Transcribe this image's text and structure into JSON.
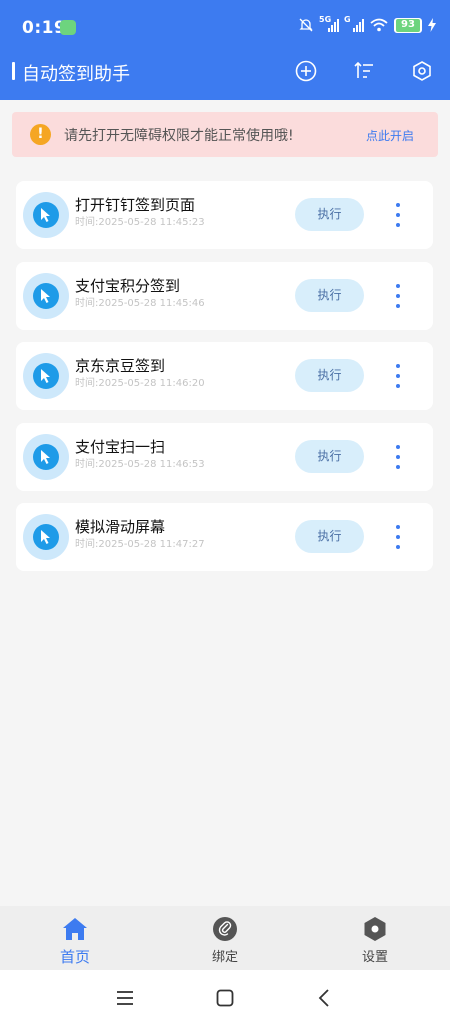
{
  "status_bar": {
    "time": "0:19",
    "network_1": "5G",
    "network_2": "G",
    "battery": "93"
  },
  "app_bar": {
    "title": "自动签到助手",
    "icons": [
      "add-circle-icon",
      "sort-icon",
      "settings-hexagon-icon"
    ]
  },
  "notice": {
    "icon": "warning-icon",
    "icon_glyph": "!",
    "text": "请先打开无障碍权限才能正常使用哦!",
    "action": "点此开启"
  },
  "tasks": [
    {
      "name": "打开钉钉签到页面",
      "time": "时间:2025-05-28 11:45:23",
      "action": "执行"
    },
    {
      "name": "支付宝积分签到",
      "time": "时间:2025-05-28 11:45:46",
      "action": "执行"
    },
    {
      "name": "京东京豆签到",
      "time": "时间:2025-05-28 11:46:20",
      "action": "执行"
    },
    {
      "name": "支付宝扫一扫",
      "time": "时间:2025-05-28 11:46:53",
      "action": "执行"
    },
    {
      "name": "模拟滑动屏幕",
      "time": "时间:2025-05-28 11:47:27",
      "action": "执行"
    }
  ],
  "bottom_nav": [
    {
      "label": "首页",
      "icon": "home-icon",
      "active": true
    },
    {
      "label": "绑定",
      "icon": "link-icon",
      "active": false
    },
    {
      "label": "设置",
      "icon": "settings-icon",
      "active": false
    }
  ],
  "colors": {
    "primary": "#3d7bf0",
    "notice_bg": "#fbdcdc",
    "warning": "#f5a623",
    "task_icon": "#1e9be8"
  }
}
